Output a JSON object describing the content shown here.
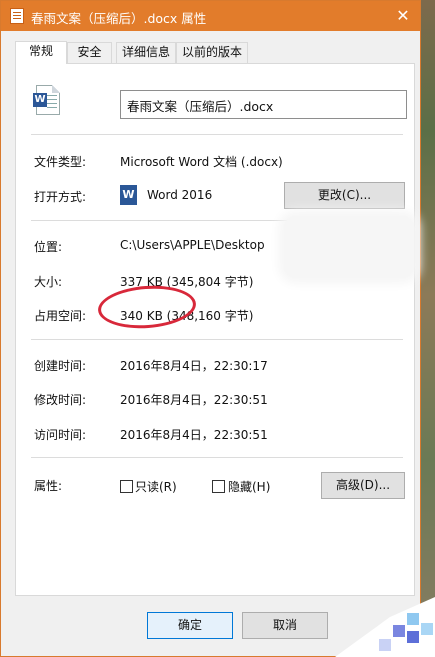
{
  "window": {
    "title": "春雨文案（压缩后）.docx 属性",
    "close_glyph": "✕"
  },
  "tabs": [
    {
      "label": "常规",
      "active": true
    },
    {
      "label": "安全",
      "active": false
    },
    {
      "label": "详细信息",
      "active": false
    },
    {
      "label": "以前的版本",
      "active": false
    }
  ],
  "general": {
    "icon_letter": "W",
    "file_name": "春雨文案（压缩后）.docx",
    "file_type_label": "文件类型:",
    "file_type_value": "Microsoft Word 文档 (.docx)",
    "opens_with_label": "打开方式:",
    "opens_with_value": "Word 2016",
    "change_button": "更改(C)...",
    "location_label": "位置:",
    "location_value": "C:\\Users\\APPLE\\Desktop",
    "size_label": "大小:",
    "size_value": "337 KB (345,804 字节)",
    "size_on_disk_label": "占用空间:",
    "size_on_disk_value": "340 KB (348,160 字节)",
    "created_label": "创建时间:",
    "created_value": "2016年8月4日，22:30:17",
    "modified_label": "修改时间:",
    "modified_value": "2016年8月4日，22:30:51",
    "accessed_label": "访问时间:",
    "accessed_value": "2016年8月4日，22:30:51",
    "attributes_label": "属性:",
    "readonly_label": "只读(R)",
    "readonly_checked": false,
    "hidden_label": "隐藏(H)",
    "hidden_checked": false,
    "advanced_button": "高级(D)..."
  },
  "footer": {
    "ok_button": "确定",
    "cancel_button": "取消"
  },
  "colors": {
    "titlebar": "#e27c2b",
    "annotation_circle": "#d8283a",
    "word_blue": "#2b5797"
  }
}
